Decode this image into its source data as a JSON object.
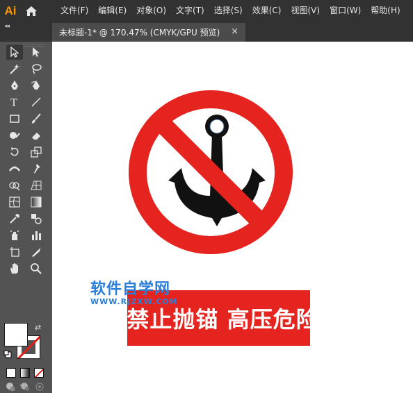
{
  "app": {
    "logo": "Ai"
  },
  "menus": [
    "文件(F)",
    "编辑(E)",
    "对象(O)",
    "文字(T)",
    "选择(S)",
    "效果(C)",
    "视图(V)",
    "窗口(W)",
    "帮助(H)"
  ],
  "tab": {
    "title": "未标题-1* @ 170.47% (CMYK/GPU 预览)",
    "close": "×"
  },
  "toolbar": {
    "collapse": "◂◂",
    "more": "···",
    "tools": [
      "selection-tool-icon",
      "direct-selection-tool-icon",
      "magic-wand-tool-icon",
      "lasso-tool-icon",
      "pen-tool-icon",
      "curvature-tool-icon",
      "type-tool-icon",
      "line-segment-tool-icon",
      "rectangle-tool-icon",
      "paintbrush-tool-icon",
      "shaper-tool-icon",
      "eraser-tool-icon",
      "rotate-tool-icon",
      "scale-tool-icon",
      "width-tool-icon",
      "puppet-warp-tool-icon",
      "shape-builder-tool-icon",
      "perspective-grid-tool-icon",
      "mesh-tool-icon",
      "gradient-tool-icon",
      "eyedropper-tool-icon",
      "blend-tool-icon",
      "symbol-sprayer-tool-icon",
      "column-graph-tool-icon",
      "artboard-tool-icon",
      "slice-tool-icon",
      "hand-tool-icon",
      "zoom-tool-icon"
    ],
    "swap_icon": "⇄"
  },
  "canvas": {
    "warning_text": "禁止抛锚 高压危险",
    "watermark_title": "软件自学网",
    "watermark_url": "WWW.RJZXW.COM"
  },
  "colors": {
    "sign_red": "#e5231f",
    "anchor_black": "#111111",
    "watermark_blue": "#2b7fd8",
    "logo_orange": "#ff9a00"
  }
}
